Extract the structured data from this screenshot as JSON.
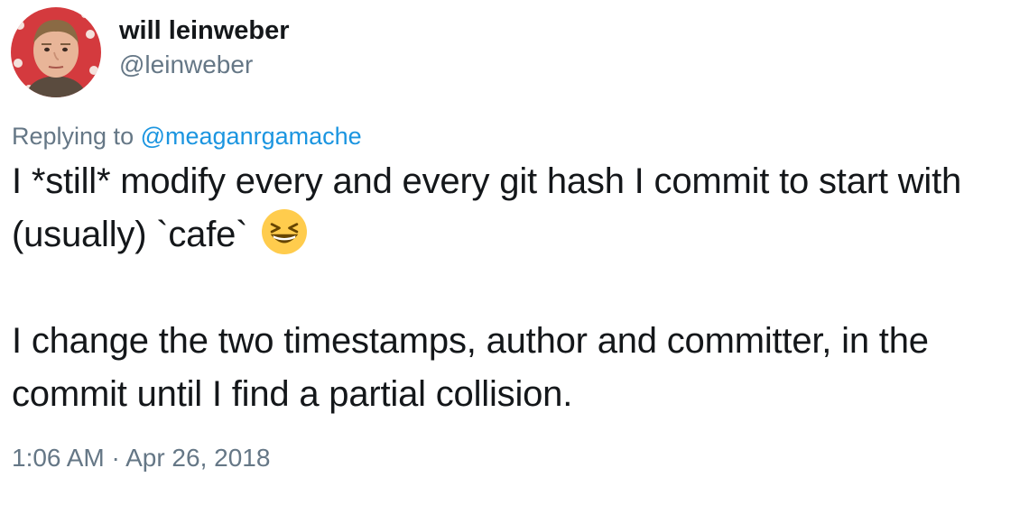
{
  "author": {
    "name": "will leinweber",
    "handle": "@leinweber"
  },
  "reply": {
    "prefix": "Replying to",
    "mention": "@meaganrgamache"
  },
  "tweet": {
    "para1": "I *still* modify every and every git hash I commit to start with (usually) `cafe`",
    "emoji": "grinning-squinting-face-icon",
    "para2": "I change the two timestamps, author and committer, in the commit until I find a partial collision."
  },
  "timestamp": "1:06 AM · Apr 26, 2018",
  "colors": {
    "text": "#14171a",
    "secondary": "#657786",
    "link": "#1b95e0",
    "emoji_face": "#ffcc4d"
  }
}
